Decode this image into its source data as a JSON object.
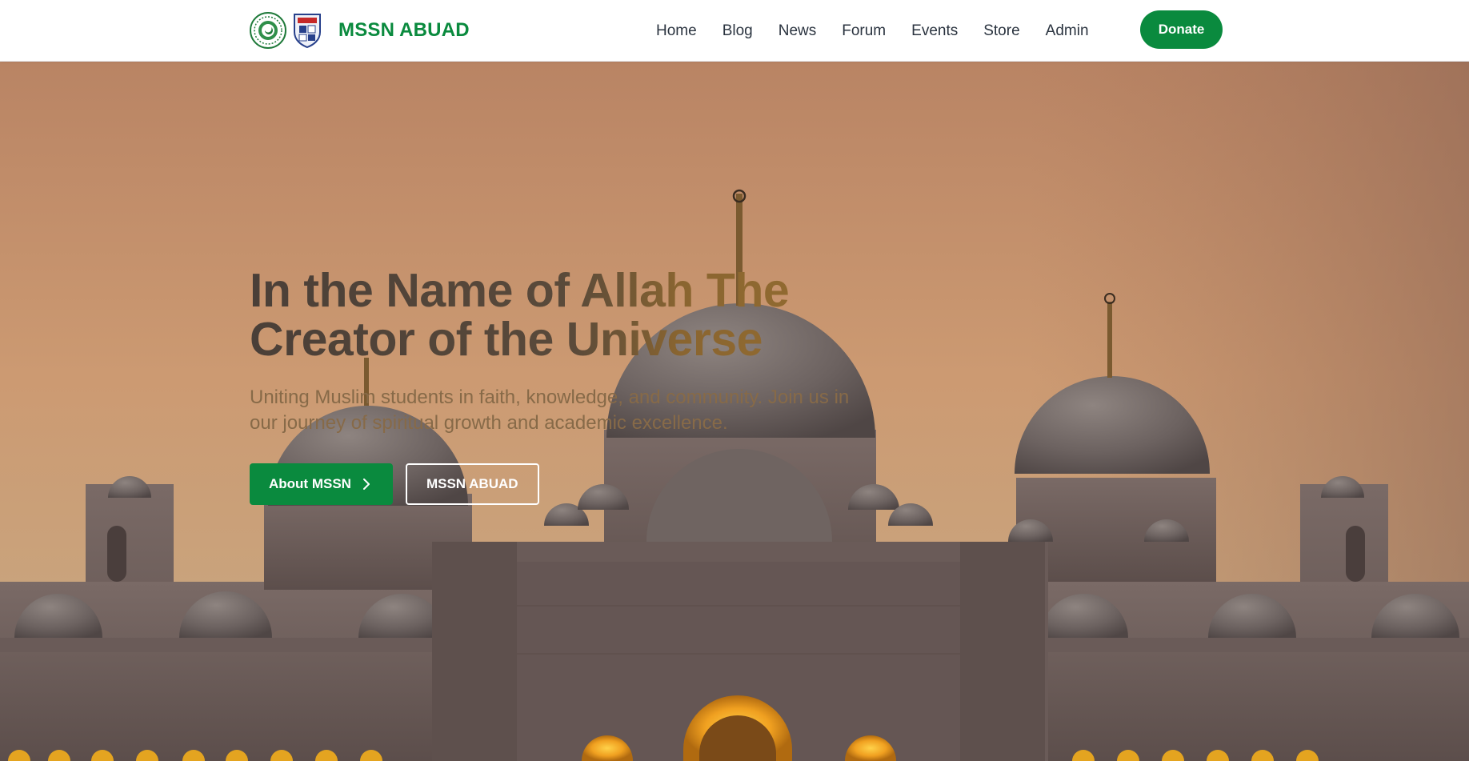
{
  "header": {
    "brand_name": "MSSN ABUAD",
    "logo_icons": [
      "mssn-seal-icon",
      "university-crest-icon"
    ],
    "nav": [
      {
        "label": "Home"
      },
      {
        "label": "Blog"
      },
      {
        "label": "News"
      },
      {
        "label": "Forum"
      },
      {
        "label": "Events"
      },
      {
        "label": "Store"
      },
      {
        "label": "Admin"
      }
    ],
    "donate_label": "Donate"
  },
  "hero": {
    "title_line1": "In the Name of Allah The",
    "title_line2": "Creator of the Universe",
    "subtitle": "Uniting Muslim students in faith, knowledge, and community. Join us in our journey of spiritual growth and academic excellence.",
    "primary_button": "About MSSN",
    "primary_button_icon": "chevron-right-icon",
    "secondary_button": "MSSN ABUAD",
    "background_image": "mosque-at-sunset"
  },
  "colors": {
    "brand_green": "#0a8a3e",
    "nav_text": "#2b3440",
    "sky_top": "#c08a68",
    "sky_bottom": "#d0a57c"
  }
}
